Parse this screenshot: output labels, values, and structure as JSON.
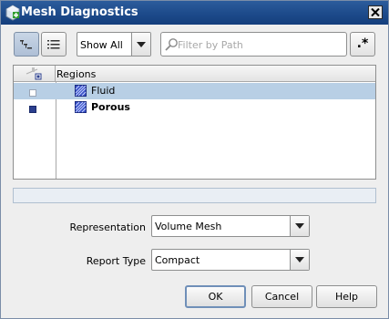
{
  "window": {
    "title": "Mesh Diagnostics",
    "title_bar_color": "#1e4c8c"
  },
  "toolbar": {
    "tree_view_icon": "tree-view-icon",
    "list_view_icon": "list-view-icon",
    "show_filter": {
      "selected": "Show All"
    },
    "filter_input": {
      "placeholder": "Filter by Path",
      "value": ""
    },
    "regex_label": ".*"
  },
  "table": {
    "header": {
      "regions_label": "Regions"
    },
    "rows": [
      {
        "name": "Fluid",
        "state": "unchecked",
        "selected": true,
        "bold": false
      },
      {
        "name": "Porous",
        "state": "checked",
        "selected": false,
        "bold": true
      }
    ],
    "selection_color": "#b8cfe5"
  },
  "form": {
    "representation_label": "Representation",
    "representation_value": "Volume Mesh",
    "report_type_label": "Report Type",
    "report_type_value": "Compact"
  },
  "buttons": {
    "ok": "OK",
    "cancel": "Cancel",
    "help": "Help"
  }
}
